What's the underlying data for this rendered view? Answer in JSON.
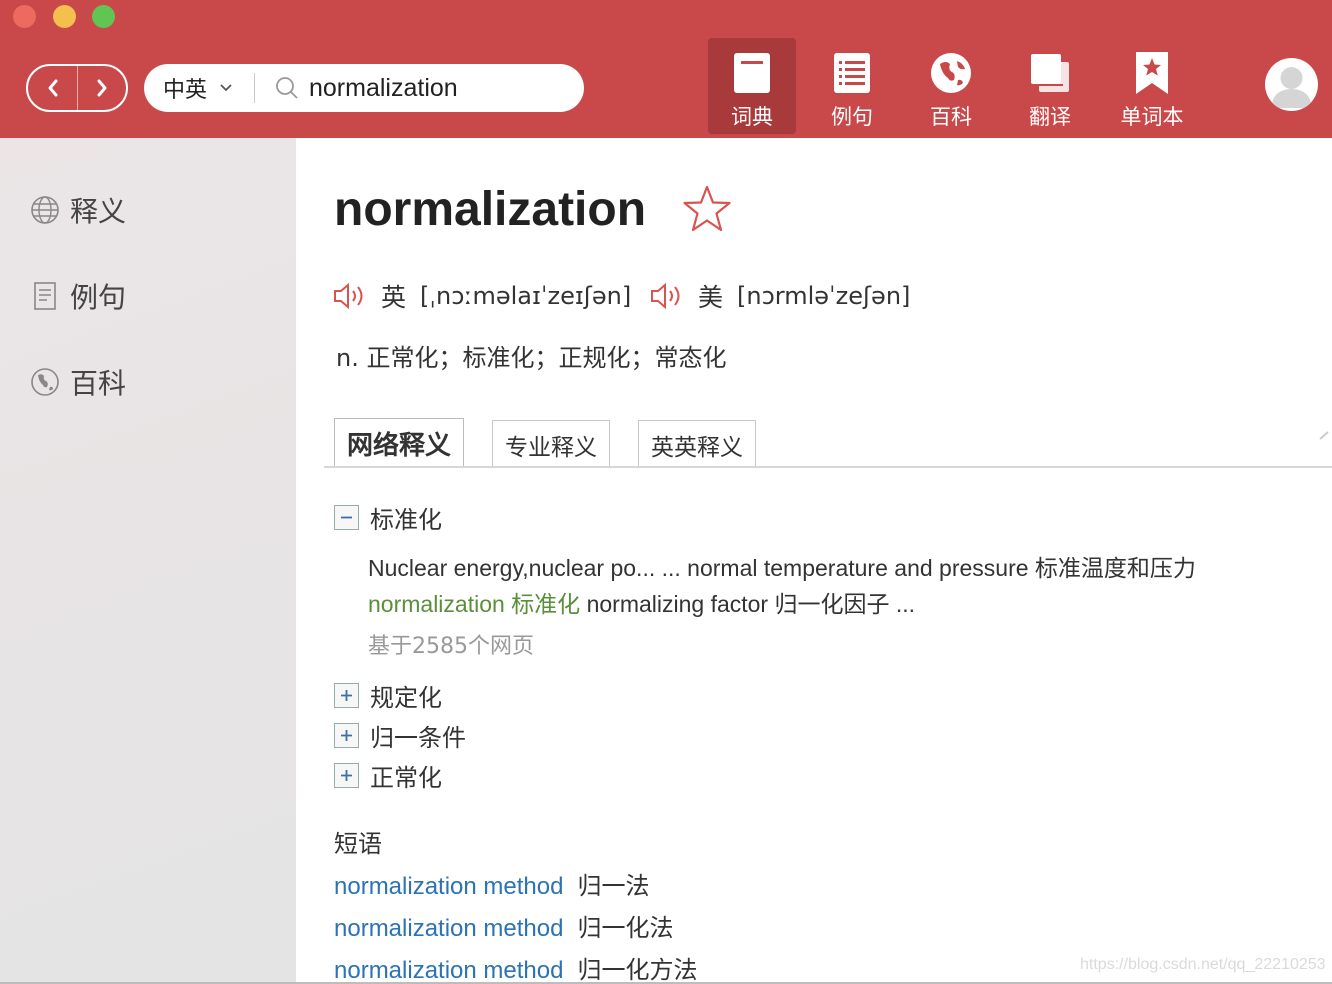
{
  "nav": {
    "back_icon": "chevron-left-icon",
    "forward_icon": "chevron-right-icon"
  },
  "search": {
    "lang": "中英",
    "value": "normalization"
  },
  "toptabs": [
    {
      "label": "词典",
      "icon": "book-icon",
      "active": true
    },
    {
      "label": "例句",
      "icon": "list-icon"
    },
    {
      "label": "百科",
      "icon": "globe-icon"
    },
    {
      "label": "翻译",
      "icon": "copy-icon"
    },
    {
      "label": "单词本",
      "icon": "bookmark-star-icon"
    }
  ],
  "sidebar": {
    "items": [
      {
        "label": "释义",
        "icon": "globe-icon"
      },
      {
        "label": "例句",
        "icon": "document-icon"
      },
      {
        "label": "百科",
        "icon": "globe-icon"
      }
    ]
  },
  "entry": {
    "word": "normalization",
    "uk_label": "英",
    "uk_ipa": "[ˌnɔːməlaɪˈzeɪʃən]",
    "us_label": "美",
    "us_ipa": "[nɔrmləˈzeʃən]",
    "basic": "n. 正常化；标准化；正规化；常态化"
  },
  "tabs": [
    "网络释义",
    "专业释义",
    "英英释义"
  ],
  "web_defs": {
    "first": {
      "label": "标准化",
      "line1": "Nuclear energy,nuclear po... ... normal temperature and pressure 标准温度和压力",
      "line2_highlight": "normalization 标准化",
      "line2_rest": " normalizing factor 归一化因子 ...",
      "source": "基于2585个网页"
    },
    "collapsed": [
      "规定化",
      "归一条件",
      "正常化"
    ]
  },
  "phrases": {
    "heading": "短语",
    "items": [
      {
        "en": "normalization method",
        "cn": "归一法"
      },
      {
        "en": "normalization method",
        "cn": "归一化法"
      },
      {
        "en": "normalization method",
        "cn": "归一化方法"
      }
    ]
  },
  "watermark": "https://blog.csdn.net/qq_22210253",
  "colors": {
    "header": "#c9484a",
    "active_tab": "#a83a3c",
    "link": "#2b73b6",
    "highlight": "#5a8f3a",
    "speaker": "#d9534f"
  }
}
